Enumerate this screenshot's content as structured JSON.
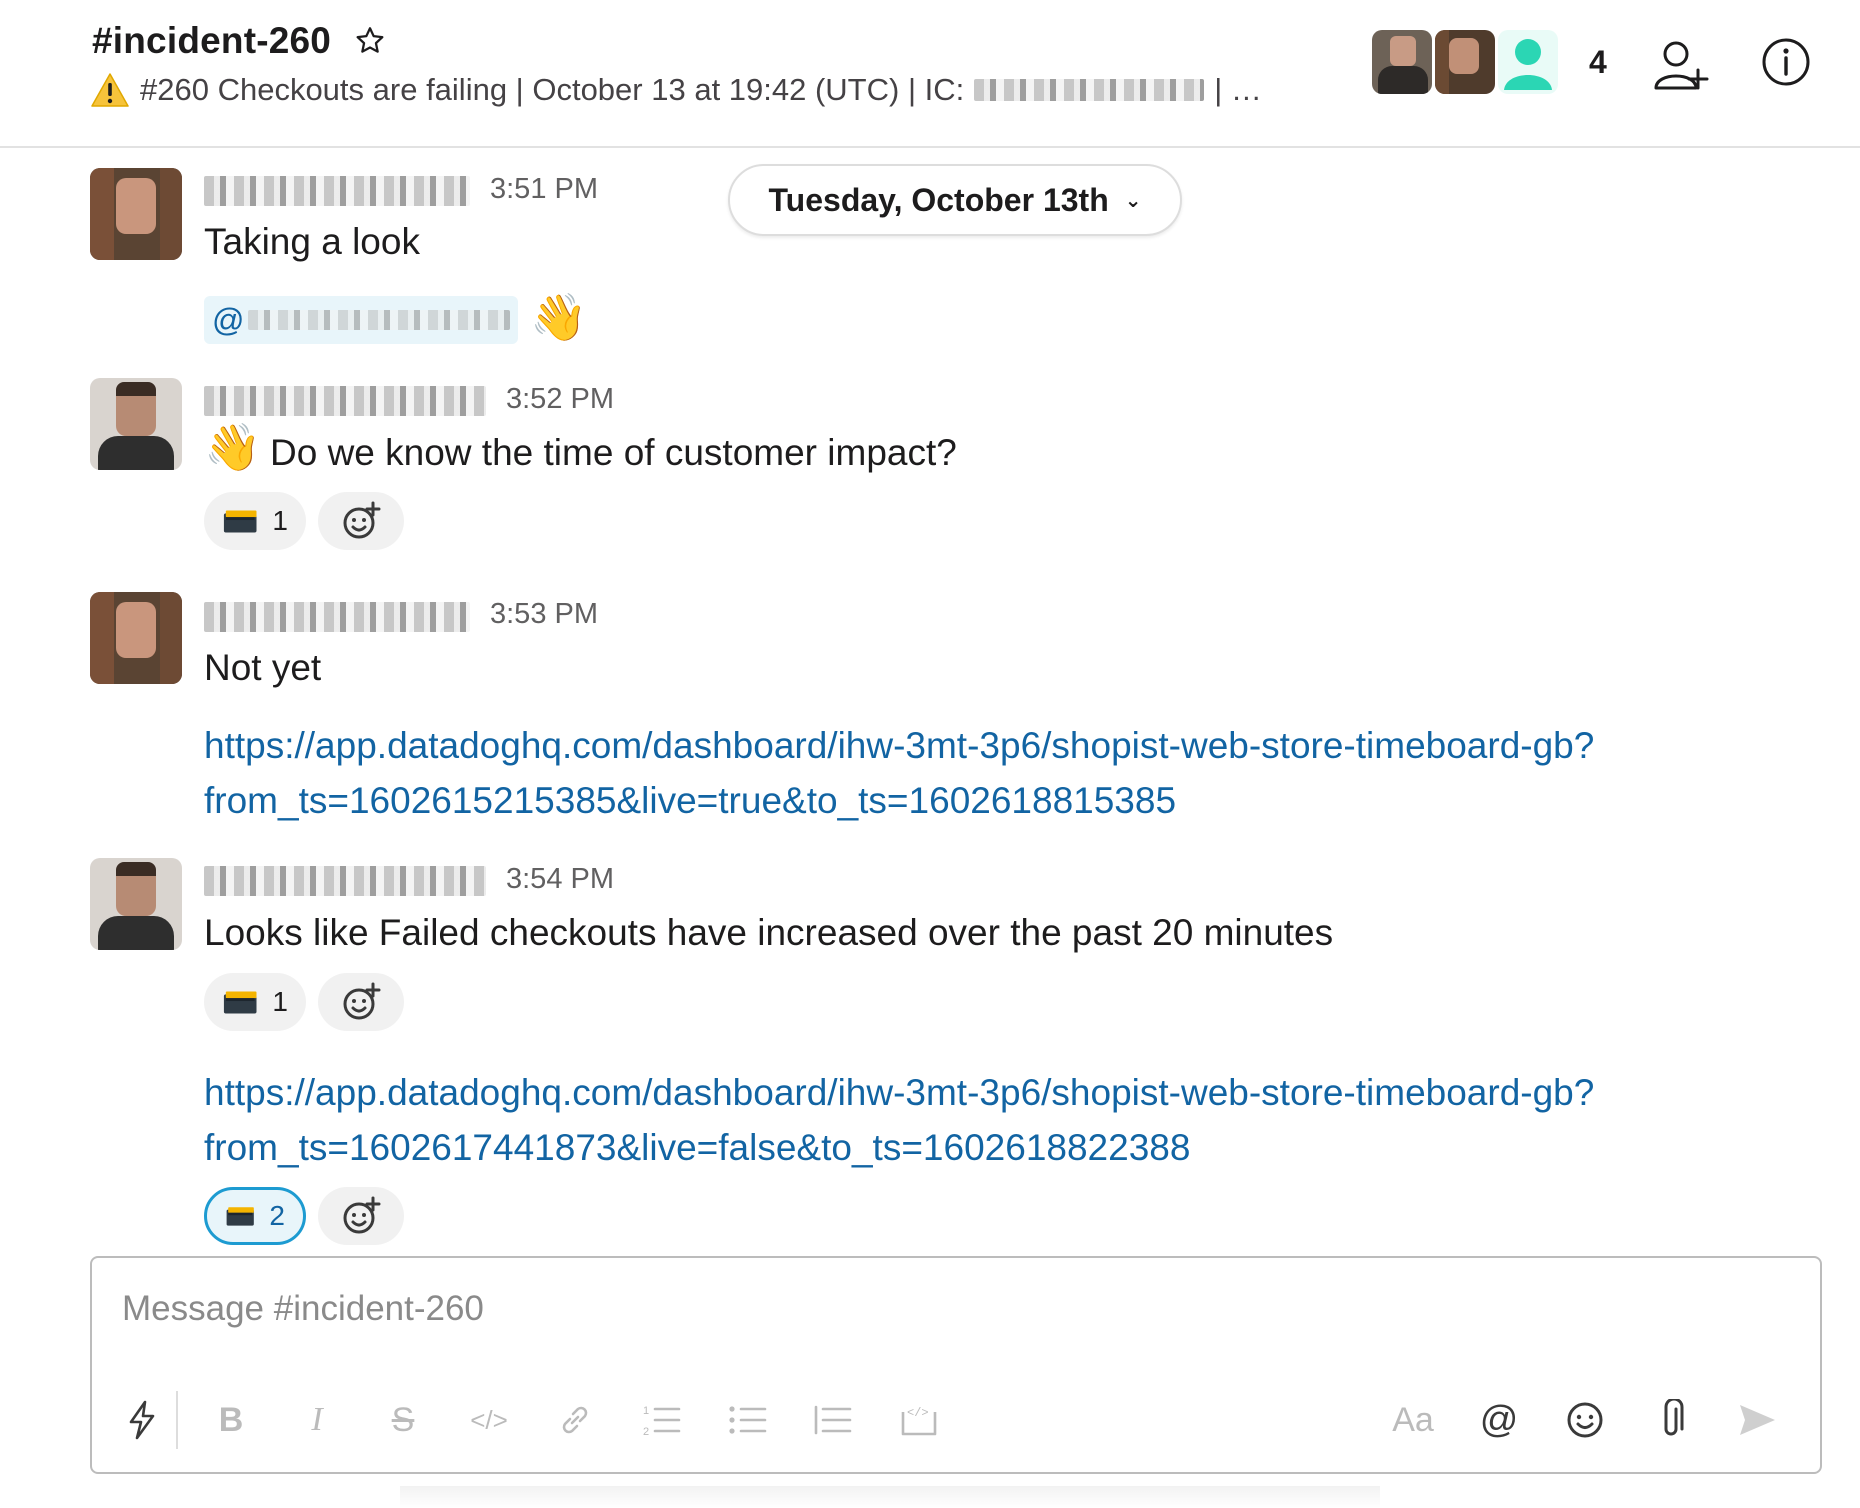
{
  "header": {
    "channel_name": "#incident-260",
    "topic_text": "#260 Checkouts are failing | October 13 at 19:42 (UTC) | IC:",
    "topic_tail": "| …",
    "member_count": "4"
  },
  "date_divider": {
    "label": "Tuesday, October 13th"
  },
  "messages": [
    {
      "time": "3:51 PM",
      "text": "Taking a look",
      "mention": "@",
      "emoji": "👋"
    },
    {
      "time": "3:52 PM",
      "emoji": "👋",
      "text": "Do we know the time of customer impact?",
      "reactions": [
        {
          "emoji": "film-frames",
          "count": "1"
        }
      ]
    },
    {
      "time": "3:53 PM",
      "text": "Not yet",
      "link_line1": "https://app.datadoghq.com/dashboard/ihw-3mt-3p6/shopist-web-store-timeboard-gb?",
      "link_line2": "from_ts=1602615215385&live=true&to_ts=1602618815385"
    },
    {
      "time": "3:54 PM",
      "text": "Looks like Failed checkouts have increased over the past 20 minutes",
      "reactions": [
        {
          "emoji": "film-frames",
          "count": "1"
        }
      ],
      "link_line1": "https://app.datadoghq.com/dashboard/ihw-3mt-3p6/shopist-web-store-timeboard-gb?",
      "link_line2": "from_ts=1602617441873&live=false&to_ts=1602618822388",
      "link_reactions": [
        {
          "emoji": "film-frames",
          "count": "2",
          "active": true
        }
      ]
    }
  ],
  "composer": {
    "placeholder": "Message #incident-260",
    "format_label": "Aa"
  },
  "colors": {
    "link": "#1264a3",
    "reaction_active_border": "#1d9bd1",
    "member_icon": "#2bd6b4"
  }
}
